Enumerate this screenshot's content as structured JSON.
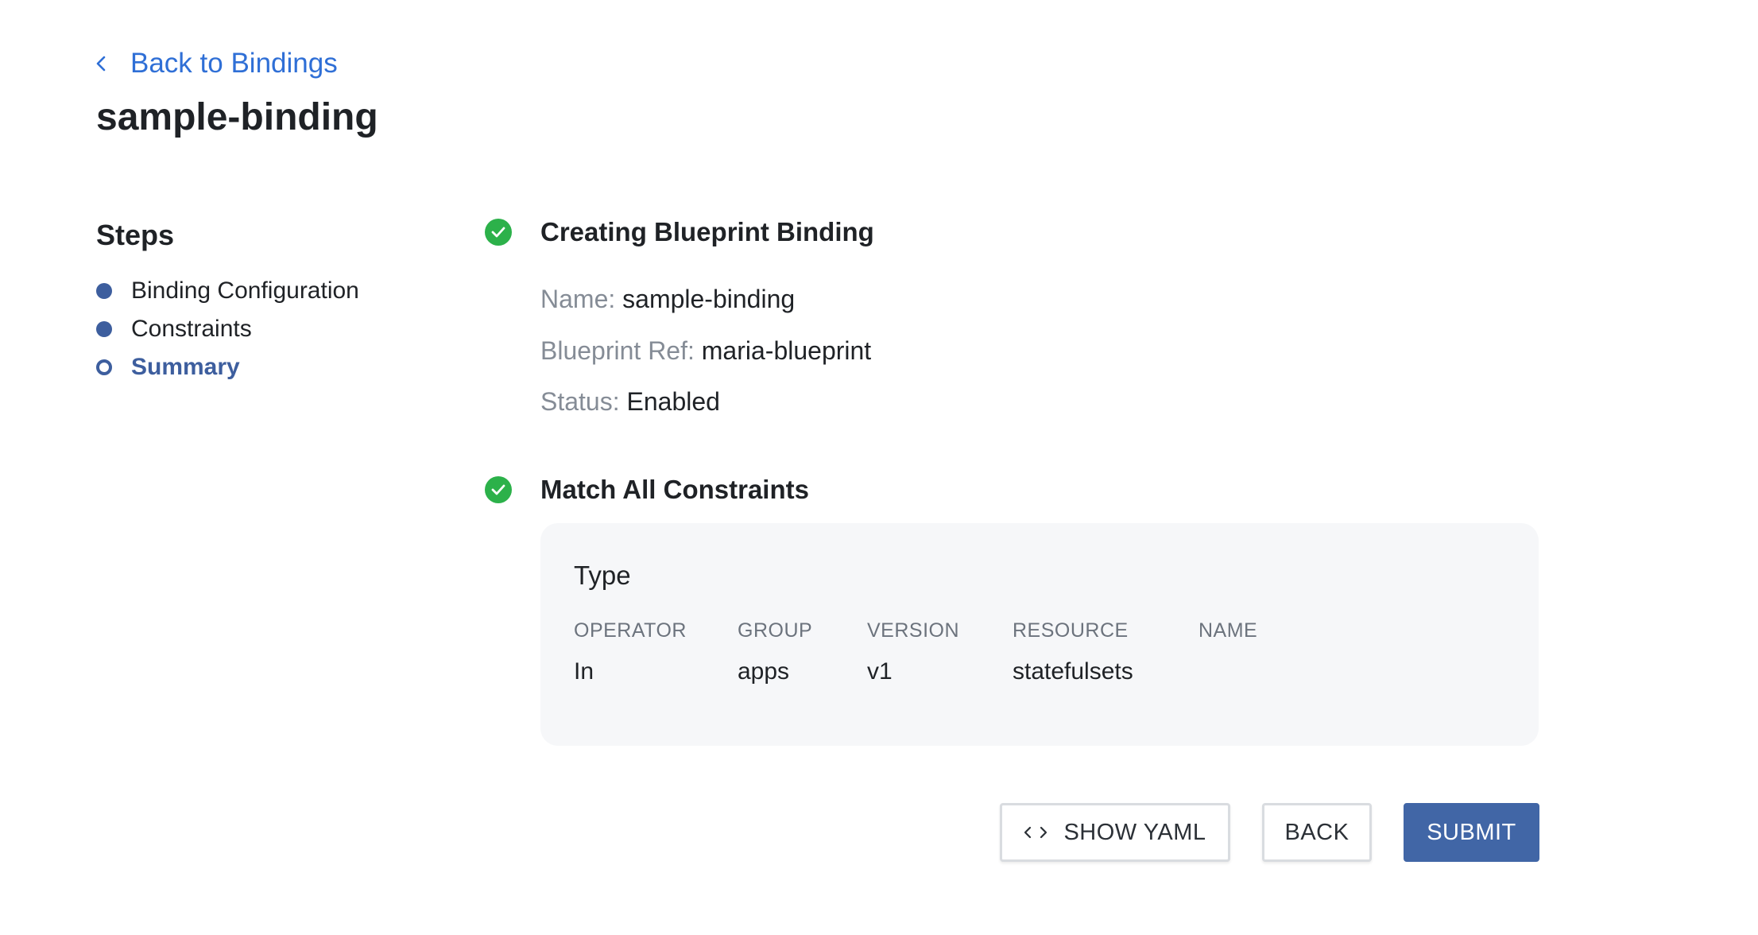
{
  "back_link": {
    "label": "Back to Bindings"
  },
  "page_title": "sample-binding",
  "steps": {
    "heading": "Steps",
    "items": [
      {
        "label": "Binding Configuration",
        "state": "done"
      },
      {
        "label": "Constraints",
        "state": "done"
      },
      {
        "label": "Summary",
        "state": "active"
      }
    ]
  },
  "creating_section": {
    "title": "Creating Blueprint Binding",
    "name_label": "Name:",
    "name_value": "sample-binding",
    "blueprint_ref_label": "Blueprint Ref:",
    "blueprint_ref_value": "maria-blueprint",
    "status_label": "Status:",
    "status_value": "Enabled"
  },
  "constraints_section": {
    "title": "Match All Constraints",
    "card": {
      "title": "Type",
      "columns": [
        "OPERATOR",
        "GROUP",
        "VERSION",
        "RESOURCE",
        "NAME"
      ],
      "row": [
        "In",
        "apps",
        "v1",
        "statefulsets",
        ""
      ]
    }
  },
  "buttons": {
    "show_yaml": "SHOW YAML",
    "back": "BACK",
    "submit": "SUBMIT"
  },
  "colors": {
    "link": "#2f6fd6",
    "step_accent": "#3d5e9e",
    "success": "#2cb14a",
    "primary_button": "#4166a6"
  },
  "icons": {
    "back": "chevron-left-icon",
    "success": "check-circle-icon",
    "yaml": "code-icon"
  }
}
